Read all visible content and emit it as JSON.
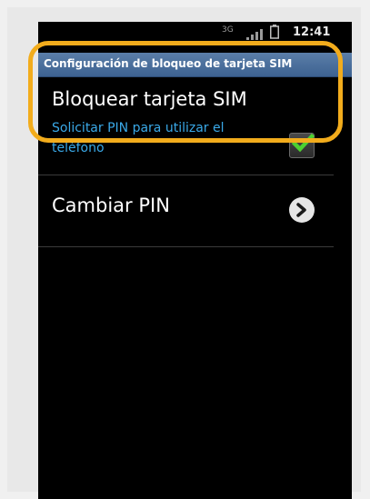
{
  "status_bar": {
    "network": "3G",
    "time": "12:41"
  },
  "screen": {
    "title": "Configuración de bloqueo de tarjeta SIM"
  },
  "settings": {
    "lock_sim": {
      "title": "Bloquear tarjeta SIM",
      "summary": "Solicitar PIN para utilizar el teléfono",
      "checked": true
    },
    "change_pin": {
      "title": "Cambiar PIN"
    }
  },
  "colors": {
    "title_bar": "#3d6291",
    "summary_text": "#3aa9e8",
    "highlight": "#f2ac1c",
    "check": "#4dd030"
  },
  "icons": {
    "checkbox": "check-icon",
    "chevron": "chevron-right-icon"
  }
}
